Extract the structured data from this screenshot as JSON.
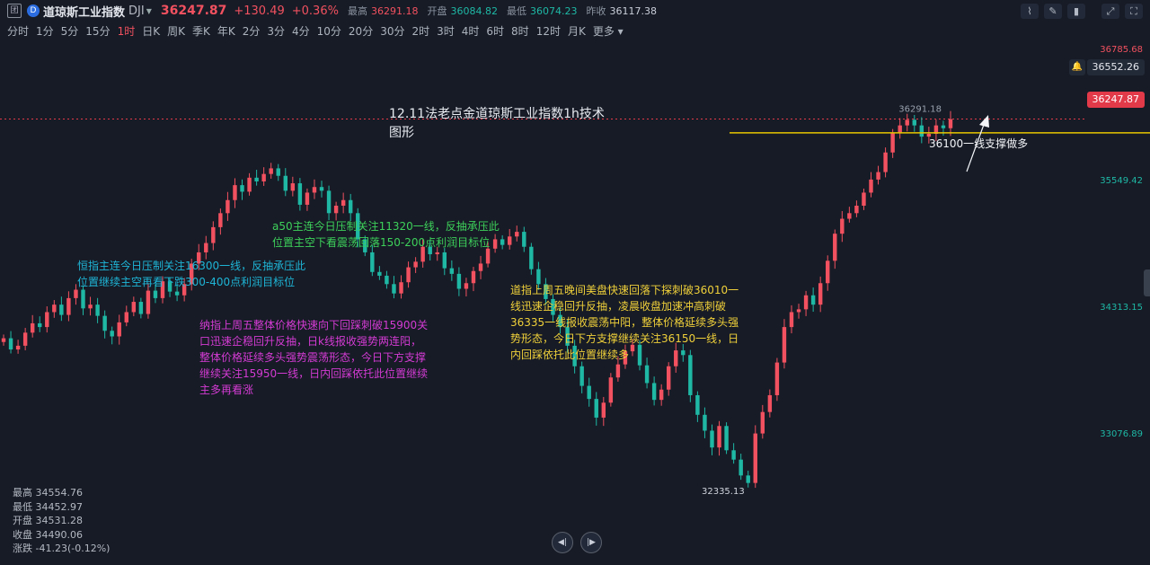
{
  "header": {
    "instrument_name": "道琼斯工业指数",
    "code": "DJI",
    "last": "36247.87",
    "change": "+130.49",
    "change_pct": "+0.36%",
    "high_label": "最高",
    "high": "36291.18",
    "open_label": "开盘",
    "open": "36084.82",
    "low_label": "最低",
    "low": "36074.23",
    "prev_close_label": "昨收",
    "prev_close": "36117.38",
    "logo_glyph": "D",
    "square_glyph": "团"
  },
  "toolbar": {
    "icons": [
      "chart-type-icon",
      "pencil-icon",
      "draw-tools-icon",
      "expand-icon",
      "fullscreen-icon"
    ],
    "glyphs": [
      "⌇",
      "✎",
      "▮",
      "⤢",
      "⛶"
    ]
  },
  "periods": [
    "分时",
    "1分",
    "5分",
    "15分",
    "1时",
    "日K",
    "周K",
    "季K",
    "年K",
    "2分",
    "3分",
    "4分",
    "10分",
    "20分",
    "30分",
    "2时",
    "3时",
    "4时",
    "6时",
    "8时",
    "12时",
    "月K",
    "更多"
  ],
  "active_period": "1时",
  "axis": {
    "labels": [
      {
        "text": "36785.68",
        "color": "#f2515f"
      },
      {
        "text": "35549.42",
        "color": "#1fb8a5"
      },
      {
        "text": "34313.15",
        "color": "#1fb8a5"
      },
      {
        "text": "33076.89",
        "color": "#1fb8a5"
      }
    ],
    "hover_price": "36552.26",
    "current_price": "36247.87"
  },
  "chart_data": {
    "type": "candlestick",
    "title": "12.11法老点金道琼斯工业指数1h技术\n图形",
    "y_range": [
      31500,
      37100
    ],
    "marked_high": "36291.18",
    "marked_low": "32335.13",
    "support_line": 36100,
    "support_label": "36100一线支撑做多",
    "closes": [
      33900,
      33780,
      33820,
      33960,
      34060,
      34020,
      34180,
      34260,
      34150,
      34330,
      34420,
      34220,
      34260,
      34140,
      33980,
      33920,
      34070,
      34180,
      34290,
      34160,
      34410,
      34330,
      34510,
      34400,
      34360,
      34480,
      34700,
      34820,
      34920,
      35090,
      35240,
      35380,
      35540,
      35470,
      35620,
      35580,
      35660,
      35720,
      35640,
      35480,
      35560,
      35330,
      35460,
      35520,
      35480,
      35240,
      35320,
      35380,
      35240,
      34960,
      34820,
      34610,
      34570,
      34480,
      34380,
      34500,
      34660,
      34720,
      34880,
      34800,
      34820,
      34650,
      34590,
      34430,
      34490,
      34620,
      34700,
      34860,
      34960,
      34900,
      34990,
      35040,
      34880,
      34640,
      34480,
      34320,
      34150,
      34020,
      33820,
      33600,
      33390,
      33250,
      33050,
      33210,
      33480,
      33620,
      33760,
      33830,
      33610,
      33420,
      33240,
      33350,
      33600,
      33770,
      33720,
      33290,
      33080,
      32910,
      32730,
      32960,
      32700,
      32600,
      32430,
      32350,
      32880,
      33110,
      33290,
      33640,
      34020,
      34180,
      34210,
      34360,
      34260,
      34490,
      34730,
      35020,
      35180,
      35240,
      35320,
      35460,
      35600,
      35680,
      35890,
      36100,
      36180,
      36240,
      36180,
      36060,
      36090,
      36180,
      36150,
      36247
    ]
  },
  "annotations": {
    "hsi": "恒指主连今日压制关注16300一线，反抽承压此\n位置继续主空再看下跌300-400点利润目标位",
    "a50": "a50主连今日压制关注11320一线，反抽承压此\n位置主空下看震荡回落150-200点利润目标位",
    "nasdaq": "纳指上周五整体价格快速向下回踩刺破15900关\n口迅速企稳回升反抽，日k线报收强势两连阳，\n整体价格延续多头强势震荡形态，今日下方支撑\n继续关注15950一线，日内回踩依托此位置继续\n主多再看涨",
    "dow": "道指上周五晚间美盘快速回落下探刺破36010一\n线迅速企稳回升反抽，凌晨收盘加速冲高刺破\n36335一线报收震荡中阳，整体价格延续多头强\n势形态，今日下方支撑继续关注36150一线，日\n内回踩依托此位置继续多"
  },
  "ohlc_panel": [
    {
      "label": "最高",
      "value": "34554.76"
    },
    {
      "label": "最低",
      "value": "34452.97"
    },
    {
      "label": "开盘",
      "value": "34531.28"
    },
    {
      "label": "收盘",
      "value": "34490.06"
    },
    {
      "label": "涨跌",
      "value": "-41.23(-0.12%)"
    }
  ],
  "colors": {
    "up": "#f2515f",
    "down": "#1fb8a5",
    "background": "#161b26",
    "support": "#e6c700",
    "hsi_text": "#1fb5d6",
    "a50_text": "#3ed15a",
    "nasdaq_text": "#d43bd3",
    "dow_text": "#f0d03a"
  }
}
